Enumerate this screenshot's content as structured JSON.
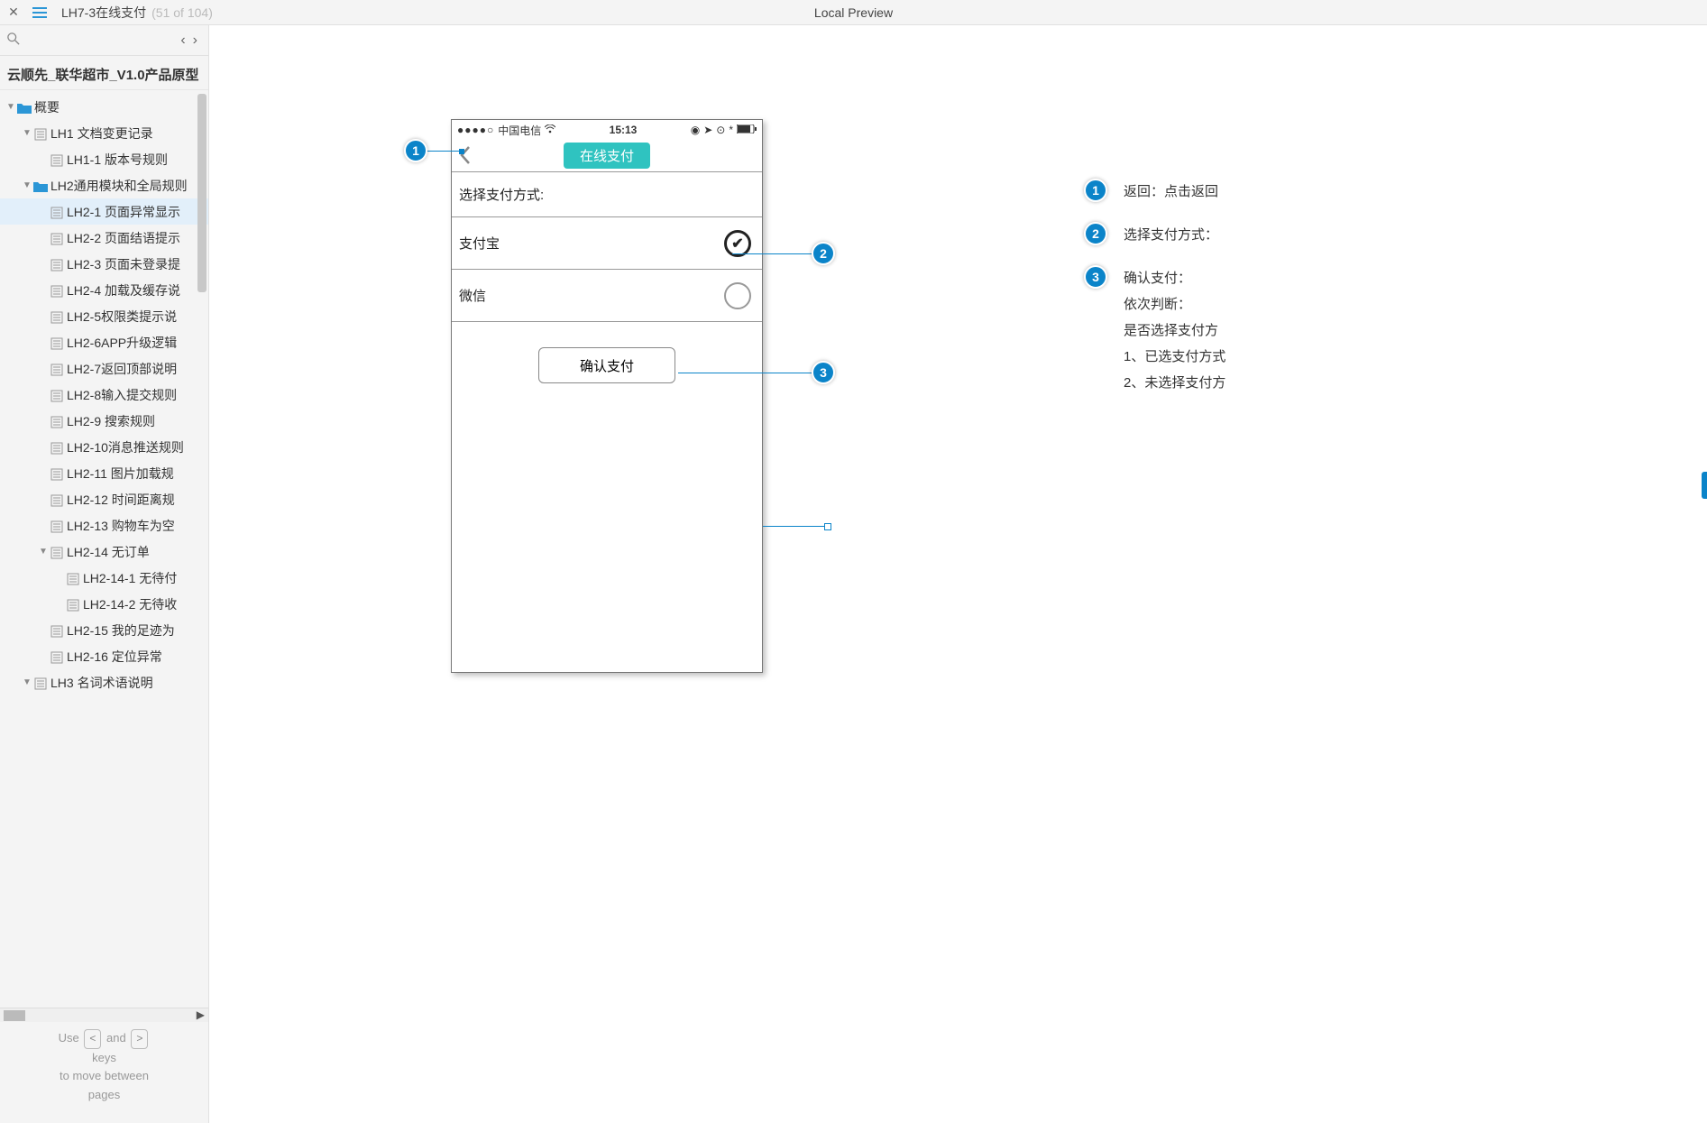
{
  "appbar": {
    "tab_title": "LH7-3在线支付",
    "tab_count": "(51 of 104)",
    "center_title": "Local Preview"
  },
  "sidebar": {
    "project_name": "云顺先_联华超市_V1.0产品原型",
    "footer": {
      "l1a": "Use",
      "l1b": "and",
      "key1": "<",
      "key2": ">",
      "l2": "keys",
      "l3": "to move between",
      "l4": "pages"
    },
    "tree": [
      {
        "indent": 0,
        "type": "folder",
        "expand": "open",
        "label": "概要"
      },
      {
        "indent": 1,
        "type": "file",
        "expand": "open",
        "label": "LH1 文档变更记录"
      },
      {
        "indent": 2,
        "type": "file",
        "expand": "none",
        "label": "LH1-1 版本号规则"
      },
      {
        "indent": 1,
        "type": "folder",
        "expand": "open",
        "label": "LH2通用模块和全局规则"
      },
      {
        "indent": 2,
        "type": "file",
        "expand": "none",
        "label": "LH2-1 页面异常显示",
        "selected": true
      },
      {
        "indent": 2,
        "type": "file",
        "expand": "none",
        "label": "LH2-2 页面结语提示"
      },
      {
        "indent": 2,
        "type": "file",
        "expand": "none",
        "label": "LH2-3 页面未登录提"
      },
      {
        "indent": 2,
        "type": "file",
        "expand": "none",
        "label": "LH2-4 加载及缓存说"
      },
      {
        "indent": 2,
        "type": "file",
        "expand": "none",
        "label": "LH2-5权限类提示说"
      },
      {
        "indent": 2,
        "type": "file",
        "expand": "none",
        "label": "LH2-6APP升级逻辑"
      },
      {
        "indent": 2,
        "type": "file",
        "expand": "none",
        "label": "LH2-7返回顶部说明"
      },
      {
        "indent": 2,
        "type": "file",
        "expand": "none",
        "label": "LH2-8输入提交规则"
      },
      {
        "indent": 2,
        "type": "file",
        "expand": "none",
        "label": "LH2-9 搜索规则"
      },
      {
        "indent": 2,
        "type": "file",
        "expand": "none",
        "label": "LH2-10消息推送规则"
      },
      {
        "indent": 2,
        "type": "file",
        "expand": "none",
        "label": "LH2-11 图片加载规"
      },
      {
        "indent": 2,
        "type": "file",
        "expand": "none",
        "label": "LH2-12 时间距离规"
      },
      {
        "indent": 2,
        "type": "file",
        "expand": "none",
        "label": "LH2-13 购物车为空"
      },
      {
        "indent": 2,
        "type": "file",
        "expand": "open",
        "label": "LH2-14 无订单"
      },
      {
        "indent": 3,
        "type": "file",
        "expand": "none",
        "label": "LH2-14-1 无待付"
      },
      {
        "indent": 3,
        "type": "file",
        "expand": "none",
        "label": "LH2-14-2 无待收"
      },
      {
        "indent": 2,
        "type": "file",
        "expand": "none",
        "label": "LH2-15 我的足迹为"
      },
      {
        "indent": 2,
        "type": "file",
        "expand": "none",
        "label": "LH2-16 定位异常"
      },
      {
        "indent": 1,
        "type": "file",
        "expand": "open",
        "label": "LH3 名词术语说明"
      }
    ]
  },
  "phone": {
    "carrier": "中国电信",
    "time": "15:13",
    "title_pill": "在线支付",
    "section_label": "选择支付方式:",
    "option1": "支付宝",
    "option2": "微信",
    "confirm": "确认支付"
  },
  "annotations": {
    "b1": "1",
    "b2": "2",
    "b3": "3"
  },
  "notes": {
    "n1": "返回：点击返回",
    "n2": "选择支付方式：",
    "n3_head": "确认支付：",
    "n3_1": "依次判断：",
    "n3_2": "是否选择支付方",
    "n3_3": "1、已选支付方式",
    "n3_4": "2、未选择支付方"
  }
}
